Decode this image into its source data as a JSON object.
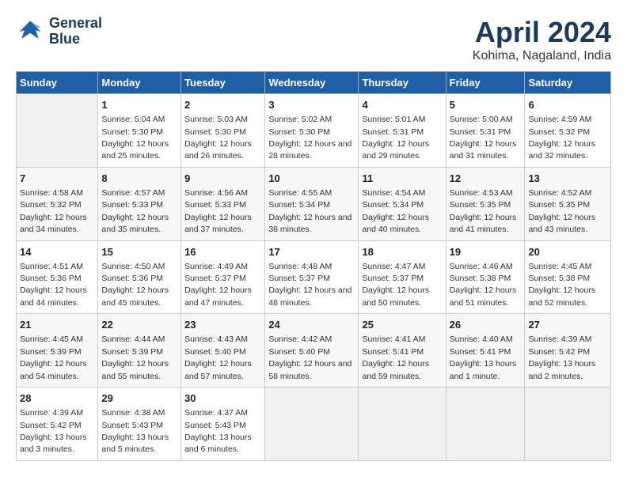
{
  "logo": {
    "line1": "General",
    "line2": "Blue"
  },
  "title": "April 2024",
  "subtitle": "Kohima, Nagaland, India",
  "days_header": [
    "Sunday",
    "Monday",
    "Tuesday",
    "Wednesday",
    "Thursday",
    "Friday",
    "Saturday"
  ],
  "weeks": [
    [
      {
        "day": "",
        "sunrise": "",
        "sunset": "",
        "daylight": ""
      },
      {
        "day": "1",
        "sunrise": "Sunrise: 5:04 AM",
        "sunset": "Sunset: 5:30 PM",
        "daylight": "Daylight: 12 hours and 25 minutes."
      },
      {
        "day": "2",
        "sunrise": "Sunrise: 5:03 AM",
        "sunset": "Sunset: 5:30 PM",
        "daylight": "Daylight: 12 hours and 26 minutes."
      },
      {
        "day": "3",
        "sunrise": "Sunrise: 5:02 AM",
        "sunset": "Sunset: 5:30 PM",
        "daylight": "Daylight: 12 hours and 28 minutes."
      },
      {
        "day": "4",
        "sunrise": "Sunrise: 5:01 AM",
        "sunset": "Sunset: 5:31 PM",
        "daylight": "Daylight: 12 hours and 29 minutes."
      },
      {
        "day": "5",
        "sunrise": "Sunrise: 5:00 AM",
        "sunset": "Sunset: 5:31 PM",
        "daylight": "Daylight: 12 hours and 31 minutes."
      },
      {
        "day": "6",
        "sunrise": "Sunrise: 4:59 AM",
        "sunset": "Sunset: 5:32 PM",
        "daylight": "Daylight: 12 hours and 32 minutes."
      }
    ],
    [
      {
        "day": "7",
        "sunrise": "Sunrise: 4:58 AM",
        "sunset": "Sunset: 5:32 PM",
        "daylight": "Daylight: 12 hours and 34 minutes."
      },
      {
        "day": "8",
        "sunrise": "Sunrise: 4:57 AM",
        "sunset": "Sunset: 5:33 PM",
        "daylight": "Daylight: 12 hours and 35 minutes."
      },
      {
        "day": "9",
        "sunrise": "Sunrise: 4:56 AM",
        "sunset": "Sunset: 5:33 PM",
        "daylight": "Daylight: 12 hours and 37 minutes."
      },
      {
        "day": "10",
        "sunrise": "Sunrise: 4:55 AM",
        "sunset": "Sunset: 5:34 PM",
        "daylight": "Daylight: 12 hours and 38 minutes."
      },
      {
        "day": "11",
        "sunrise": "Sunrise: 4:54 AM",
        "sunset": "Sunset: 5:34 PM",
        "daylight": "Daylight: 12 hours and 40 minutes."
      },
      {
        "day": "12",
        "sunrise": "Sunrise: 4:53 AM",
        "sunset": "Sunset: 5:35 PM",
        "daylight": "Daylight: 12 hours and 41 minutes."
      },
      {
        "day": "13",
        "sunrise": "Sunrise: 4:52 AM",
        "sunset": "Sunset: 5:35 PM",
        "daylight": "Daylight: 12 hours and 43 minutes."
      }
    ],
    [
      {
        "day": "14",
        "sunrise": "Sunrise: 4:51 AM",
        "sunset": "Sunset: 5:36 PM",
        "daylight": "Daylight: 12 hours and 44 minutes."
      },
      {
        "day": "15",
        "sunrise": "Sunrise: 4:50 AM",
        "sunset": "Sunset: 5:36 PM",
        "daylight": "Daylight: 12 hours and 45 minutes."
      },
      {
        "day": "16",
        "sunrise": "Sunrise: 4:49 AM",
        "sunset": "Sunset: 5:37 PM",
        "daylight": "Daylight: 12 hours and 47 minutes."
      },
      {
        "day": "17",
        "sunrise": "Sunrise: 4:48 AM",
        "sunset": "Sunset: 5:37 PM",
        "daylight": "Daylight: 12 hours and 48 minutes."
      },
      {
        "day": "18",
        "sunrise": "Sunrise: 4:47 AM",
        "sunset": "Sunset: 5:37 PM",
        "daylight": "Daylight: 12 hours and 50 minutes."
      },
      {
        "day": "19",
        "sunrise": "Sunrise: 4:46 AM",
        "sunset": "Sunset: 5:38 PM",
        "daylight": "Daylight: 12 hours and 51 minutes."
      },
      {
        "day": "20",
        "sunrise": "Sunrise: 4:45 AM",
        "sunset": "Sunset: 5:38 PM",
        "daylight": "Daylight: 12 hours and 52 minutes."
      }
    ],
    [
      {
        "day": "21",
        "sunrise": "Sunrise: 4:45 AM",
        "sunset": "Sunset: 5:39 PM",
        "daylight": "Daylight: 12 hours and 54 minutes."
      },
      {
        "day": "22",
        "sunrise": "Sunrise: 4:44 AM",
        "sunset": "Sunset: 5:39 PM",
        "daylight": "Daylight: 12 hours and 55 minutes."
      },
      {
        "day": "23",
        "sunrise": "Sunrise: 4:43 AM",
        "sunset": "Sunset: 5:40 PM",
        "daylight": "Daylight: 12 hours and 57 minutes."
      },
      {
        "day": "24",
        "sunrise": "Sunrise: 4:42 AM",
        "sunset": "Sunset: 5:40 PM",
        "daylight": "Daylight: 12 hours and 58 minutes."
      },
      {
        "day": "25",
        "sunrise": "Sunrise: 4:41 AM",
        "sunset": "Sunset: 5:41 PM",
        "daylight": "Daylight: 12 hours and 59 minutes."
      },
      {
        "day": "26",
        "sunrise": "Sunrise: 4:40 AM",
        "sunset": "Sunset: 5:41 PM",
        "daylight": "Daylight: 13 hours and 1 minute."
      },
      {
        "day": "27",
        "sunrise": "Sunrise: 4:39 AM",
        "sunset": "Sunset: 5:42 PM",
        "daylight": "Daylight: 13 hours and 2 minutes."
      }
    ],
    [
      {
        "day": "28",
        "sunrise": "Sunrise: 4:39 AM",
        "sunset": "Sunset: 5:42 PM",
        "daylight": "Daylight: 13 hours and 3 minutes."
      },
      {
        "day": "29",
        "sunrise": "Sunrise: 4:38 AM",
        "sunset": "Sunset: 5:43 PM",
        "daylight": "Daylight: 13 hours and 5 minutes."
      },
      {
        "day": "30",
        "sunrise": "Sunrise: 4:37 AM",
        "sunset": "Sunset: 5:43 PM",
        "daylight": "Daylight: 13 hours and 6 minutes."
      },
      {
        "day": "",
        "sunrise": "",
        "sunset": "",
        "daylight": ""
      },
      {
        "day": "",
        "sunrise": "",
        "sunset": "",
        "daylight": ""
      },
      {
        "day": "",
        "sunrise": "",
        "sunset": "",
        "daylight": ""
      },
      {
        "day": "",
        "sunrise": "",
        "sunset": "",
        "daylight": ""
      }
    ]
  ]
}
